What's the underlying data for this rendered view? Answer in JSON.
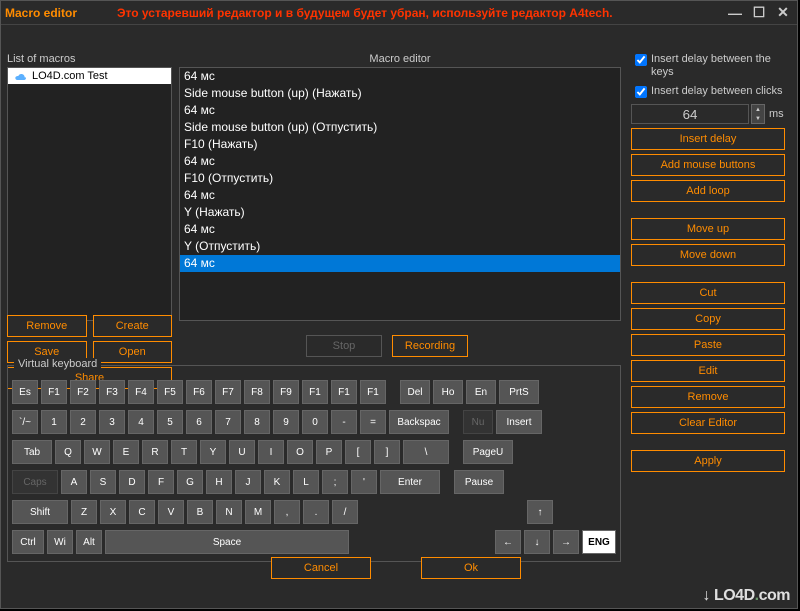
{
  "window": {
    "title": "Macro editor",
    "warning": "Это устаревший редактор и в будущем будет убран, используйте редактор A4tech."
  },
  "labels": {
    "list_of_macros": "List of macros",
    "macro_editor": "Macro editor",
    "virtual_keyboard": "Virtual keyboard"
  },
  "macros": {
    "items": [
      {
        "name": "LO4D.com Test"
      }
    ]
  },
  "editor_lines": [
    {
      "text": "64 мс",
      "selected": false
    },
    {
      "text": "Side mouse button (up) (Нажать)",
      "selected": false
    },
    {
      "text": "64 мс",
      "selected": false
    },
    {
      "text": "Side mouse button (up) (Отпустить)",
      "selected": false
    },
    {
      "text": "F10 (Нажать)",
      "selected": false
    },
    {
      "text": "64 мс",
      "selected": false
    },
    {
      "text": "F10 (Отпустить)",
      "selected": false
    },
    {
      "text": "64 мс",
      "selected": false
    },
    {
      "text": "Y (Нажать)",
      "selected": false
    },
    {
      "text": "64 мс",
      "selected": false
    },
    {
      "text": "Y (Отпустить)",
      "selected": false
    },
    {
      "text": "64 мс",
      "selected": true
    }
  ],
  "options": {
    "delay_keys": "Insert delay between the keys",
    "delay_clicks": "Insert delay between clicks",
    "delay_value": "64",
    "delay_unit": "ms"
  },
  "buttons": {
    "insert_delay": "Insert delay",
    "add_mouse": "Add mouse buttons",
    "add_loop": "Add loop",
    "move_up": "Move up",
    "move_down": "Move down",
    "cut": "Cut",
    "copy": "Copy",
    "paste": "Paste",
    "edit": "Edit",
    "remove_r": "Remove",
    "clear": "Clear Editor",
    "apply": "Apply",
    "remove": "Remove",
    "create": "Create",
    "save": "Save",
    "open": "Open",
    "share": "Share",
    "stop": "Stop",
    "recording": "Recording",
    "cancel": "Cancel",
    "ok": "Ok"
  },
  "keyboard": {
    "row1": [
      "Es",
      "F1",
      "F2",
      "F3",
      "F4",
      "F5",
      "F6",
      "F7",
      "F8",
      "F9",
      "F1",
      "F1",
      "F1"
    ],
    "row1_right": [
      "Del",
      "Ho",
      "En",
      "PrtS"
    ],
    "row2": [
      "`/~",
      "1",
      "2",
      "3",
      "4",
      "5",
      "6",
      "7",
      "8",
      "9",
      "0",
      "-",
      "=",
      "Backspac"
    ],
    "row2_right": [
      "Nu",
      "Insert"
    ],
    "row3": [
      "Tab",
      "Q",
      "W",
      "E",
      "R",
      "T",
      "Y",
      "U",
      "I",
      "O",
      "P",
      "[",
      "]",
      "\\"
    ],
    "row3_right": [
      "PageU"
    ],
    "row4": [
      "Caps",
      "A",
      "S",
      "D",
      "F",
      "G",
      "H",
      "J",
      "K",
      "L",
      ";",
      "'",
      "Enter"
    ],
    "row4_right": [
      "Pause"
    ],
    "row5": [
      "Shift",
      "Z",
      "X",
      "C",
      "V",
      "B",
      "N",
      "M",
      ",",
      ".",
      "/"
    ],
    "row5_arrow": "↑",
    "row6": [
      "Ctrl",
      "Wi",
      "Alt",
      "Space"
    ],
    "row6_arrows": [
      "←",
      "↓",
      "→"
    ],
    "lang": "ENG"
  },
  "watermark": "LO4D.com"
}
